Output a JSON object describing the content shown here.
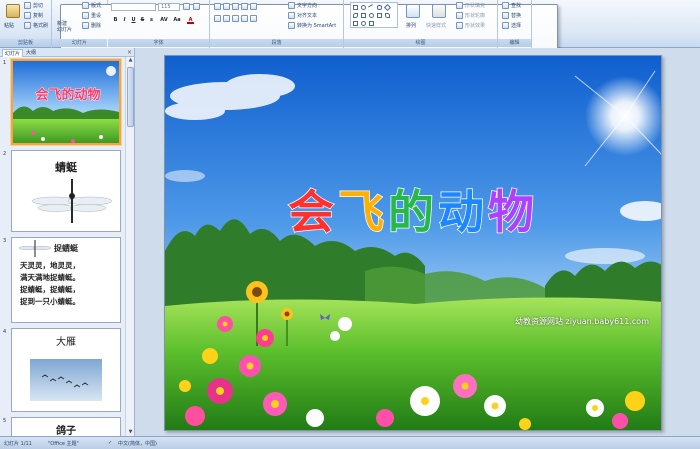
{
  "ribbon": {
    "clipboard": {
      "label": "剪贴板",
      "paste": "粘贴",
      "cut": "剪切",
      "copy": "复制",
      "format_painter": "格式刷"
    },
    "slides": {
      "label": "幻灯片",
      "new_slide": "新建\n幻灯片",
      "layout": "版式",
      "reset": "重设",
      "delete": "删除"
    },
    "font": {
      "label": "字体",
      "font_size": "115",
      "bold": "B",
      "italic": "I",
      "underline": "U",
      "strike": "S",
      "shadow": "s",
      "char_spacing": "AV",
      "change_case": "Aa",
      "color": "A"
    },
    "paragraph": {
      "label": "段落",
      "text_direction": "文字方向",
      "align_text": "对齐文本",
      "smartart": "转换为 SmartArt"
    },
    "drawing": {
      "label": "绘图",
      "arrange": "排列",
      "quick_styles": "快速样式",
      "shape_fill": "形状填充",
      "shape_outline": "形状轮廓",
      "shape_effects": "形状效果"
    },
    "editing": {
      "label": "编辑",
      "find": "查找",
      "replace": "替换",
      "select": "选择"
    }
  },
  "panel": {
    "tab_slides": "幻灯片",
    "tab_outline": "大纲",
    "close": "×"
  },
  "thumbnails": [
    {
      "num": "1",
      "title": "会飞的动物"
    },
    {
      "num": "2",
      "title": "蜻蜓"
    },
    {
      "num": "3",
      "title": "捉蜻蜓",
      "lines": [
        "天灵灵，地灵灵，",
        "满天满地捉蜻蜓。",
        "捉蜻蜓，捉蜻蜓，",
        "捉到一只小蜻蜓。"
      ]
    },
    {
      "num": "4",
      "title": "大雁"
    },
    {
      "num": "5",
      "title": "鸽子"
    }
  ],
  "slide": {
    "title_chars": [
      "会",
      "飞",
      "的",
      "动",
      "物"
    ],
    "title_colors": [
      "#ff2a2a",
      "#ff9a00",
      "#ffd400",
      "#2fc12f",
      "#1e86ff",
      "#a040ff"
    ],
    "watermark": "幼教资源网站 ziyuan.baby611.com"
  },
  "status": {
    "slide_info": "幻灯片 1/11",
    "theme": "\"Office 主题\"",
    "language": "中文(简体，中国)"
  }
}
